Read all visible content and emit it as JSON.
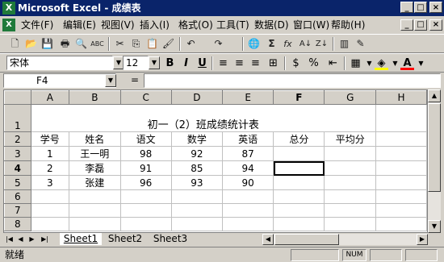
{
  "titlebar": {
    "app_icon": "X",
    "title": "Microsoft Excel - 成绩表",
    "minimize": "_",
    "maximize": "□",
    "close": "×"
  },
  "menubar": {
    "doc_icon": "X",
    "items": [
      "文件(F)",
      "编辑(E)",
      "视图(V)",
      "插入(I)",
      "格式(O)",
      "工具(T)",
      "数据(D)",
      "窗口(W)",
      "帮助(H)"
    ],
    "doc_controls": [
      "_",
      "□",
      "×"
    ]
  },
  "toolbar_standard": {
    "icons": [
      "new-icon",
      "open-icon",
      "save-icon",
      "print-icon",
      "print-preview-icon",
      "spelling-icon",
      "cut-icon",
      "copy-icon",
      "paste-icon",
      "format-painter-icon",
      "undo-icon",
      "redo-icon",
      "hyperlink-icon",
      "autosum-icon",
      "function-icon",
      "sort-ascending-icon",
      "sort-descending-icon",
      "chart-wizard-icon",
      "drawing-icon"
    ],
    "glyphs": [
      "🗋",
      "📂",
      "💾",
      "🖶",
      "🔍",
      "ABC",
      "✂",
      "⎘",
      "📋",
      "🖌",
      "↶",
      "↷",
      "🌐",
      "Σ",
      "fx",
      "A↓",
      "Z↓",
      "▥",
      "✎"
    ]
  },
  "toolbar_format": {
    "font_name": "宋体",
    "font_size": "12",
    "bold": "B",
    "italic": "I",
    "underline": "U",
    "align_icons": [
      "align-left-icon",
      "align-center-icon",
      "align-right-icon",
      "merge-center-icon"
    ],
    "align_glyphs": [
      "≡",
      "≡",
      "≡",
      "⊞"
    ],
    "number_icons": [
      "currency-icon",
      "percent-icon",
      "indent-icon"
    ],
    "number_glyphs": [
      "$",
      "%",
      "⇤"
    ],
    "border_glyph": "▦",
    "fill_glyph": "◈",
    "font_color_glyph": "A",
    "colors": {
      "fill": "#ffff00",
      "font": "#ff0000"
    }
  },
  "formula_bar": {
    "cell_ref": "F4",
    "eq": "=",
    "value": ""
  },
  "grid": {
    "columns": [
      "A",
      "B",
      "C",
      "D",
      "E",
      "F",
      "G",
      "H"
    ],
    "rows": [
      "1",
      "2",
      "3",
      "4",
      "5",
      "6",
      "7",
      "8"
    ],
    "selected_cell": "F4",
    "title": "初一（2）班成绩统计表",
    "headers": [
      "学号",
      "姓名",
      "语文",
      "数学",
      "英语",
      "总分",
      "平均分"
    ],
    "data": [
      [
        "1",
        "王一明",
        "98",
        "92",
        "87"
      ],
      [
        "2",
        "李磊",
        "91",
        "85",
        "94"
      ],
      [
        "3",
        "张建",
        "96",
        "93",
        "90"
      ]
    ]
  },
  "sheets": {
    "nav": [
      "|◀",
      "◀",
      "▶",
      "▶|"
    ],
    "tabs": [
      "Sheet1",
      "Sheet2",
      "Sheet3"
    ],
    "active": "Sheet1"
  },
  "hscroll": {
    "left": "◀",
    "right": "▶"
  },
  "vscroll": {
    "up": "▲",
    "down": "▼"
  },
  "statusbar": {
    "text": "就绪",
    "num": "NUM"
  }
}
